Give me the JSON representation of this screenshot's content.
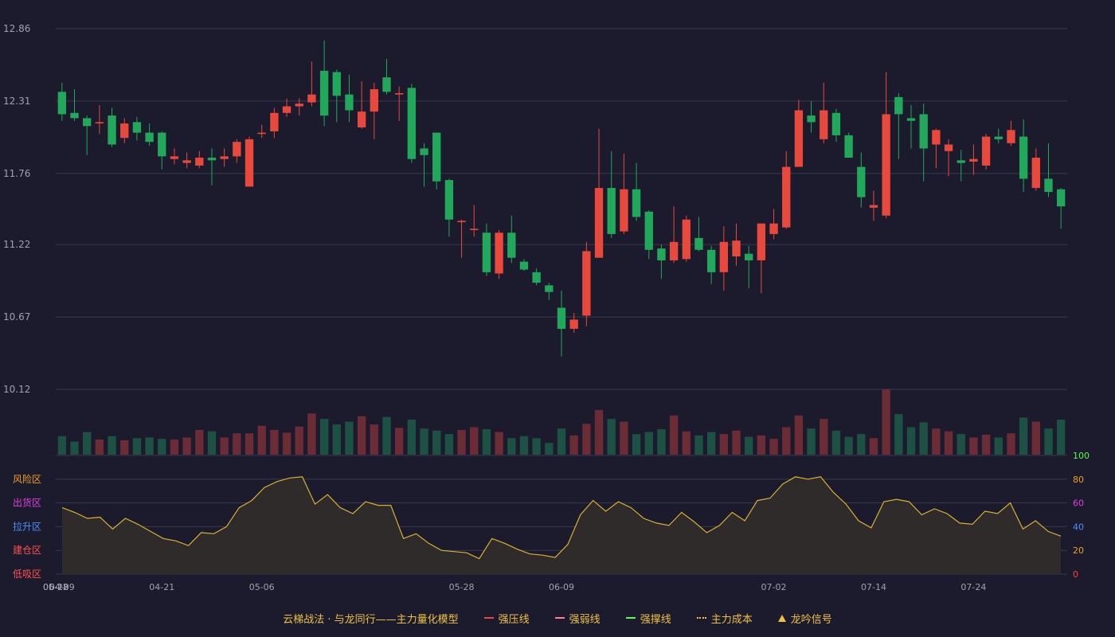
{
  "chart_data": [
    {
      "type": "candlestick",
      "panel": "price",
      "y_ticks": [
        "12.86",
        "12.31",
        "11.76",
        "11.22",
        "10.67",
        "10.12"
      ],
      "ylim": [
        10.12,
        12.86
      ],
      "grid": true,
      "up_color": "#e8493c",
      "down_color": "#22a85a",
      "x": [
        "04-09",
        "04-10",
        "04-11",
        "04-14",
        "04-15",
        "04-16",
        "04-17",
        "04-18",
        "04-21",
        "04-22",
        "04-23",
        "04-24",
        "04-25",
        "04-28",
        "04-29",
        "04-30",
        "05-06",
        "05-07",
        "05-08",
        "05-09",
        "05-12",
        "05-13",
        "05-14",
        "05-15",
        "05-16",
        "05-19",
        "05-20",
        "05-21",
        "05-22",
        "05-23",
        "05-26",
        "05-27",
        "05-28",
        "05-29",
        "05-30",
        "06-02",
        "06-03",
        "06-04",
        "06-05",
        "06-06",
        "06-09",
        "06-10",
        "06-11",
        "06-12",
        "06-13",
        "06-16",
        "06-17",
        "06-18",
        "06-19",
        "06-20",
        "06-23",
        "06-24",
        "06-25",
        "06-26",
        "06-27",
        "06-30",
        "07-01",
        "07-02",
        "07-03",
        "07-04",
        "07-07",
        "07-08",
        "07-09",
        "07-10",
        "07-11",
        "07-14",
        "07-15",
        "07-16",
        "07-17",
        "07-18",
        "07-21",
        "07-22",
        "07-23",
        "07-24",
        "07-25",
        "07-28",
        "07-29",
        "07-30",
        "07-31",
        "08-01"
      ],
      "ohlc": [
        [
          12.38,
          12.21,
          12.16,
          12.45
        ],
        [
          12.22,
          12.18,
          12.16,
          12.4
        ],
        [
          12.18,
          12.12,
          11.9,
          12.2
        ],
        [
          12.14,
          12.15,
          12.06,
          12.28
        ],
        [
          12.2,
          11.98,
          11.96,
          12.26
        ],
        [
          12.03,
          12.14,
          11.99,
          12.18
        ],
        [
          12.15,
          12.07,
          12.01,
          12.19
        ],
        [
          12.07,
          12.0,
          11.97,
          12.14
        ],
        [
          12.07,
          11.89,
          11.79,
          12.08
        ],
        [
          11.87,
          11.89,
          11.83,
          11.95
        ],
        [
          11.84,
          11.86,
          11.8,
          11.92
        ],
        [
          11.82,
          11.88,
          11.8,
          11.93
        ],
        [
          11.88,
          11.86,
          11.67,
          11.95
        ],
        [
          11.87,
          11.89,
          11.81,
          11.95
        ],
        [
          11.89,
          12.0,
          11.84,
          12.02
        ],
        [
          11.66,
          12.02,
          11.66,
          12.04
        ],
        [
          12.06,
          12.07,
          12.03,
          12.13
        ],
        [
          12.08,
          12.22,
          12.03,
          12.26
        ],
        [
          12.22,
          12.27,
          12.19,
          12.33
        ],
        [
          12.27,
          12.29,
          12.2,
          12.33
        ],
        [
          12.3,
          12.36,
          12.27,
          12.61
        ],
        [
          12.54,
          12.2,
          12.12,
          12.77
        ],
        [
          12.53,
          12.35,
          12.15,
          12.55
        ],
        [
          12.36,
          12.24,
          12.15,
          12.51
        ],
        [
          12.11,
          12.23,
          12.1,
          12.46
        ],
        [
          12.23,
          12.4,
          12.02,
          12.45
        ],
        [
          12.49,
          12.38,
          12.36,
          12.63
        ],
        [
          12.36,
          12.37,
          12.16,
          12.42
        ],
        [
          12.41,
          11.87,
          11.84,
          12.44
        ],
        [
          11.95,
          11.9,
          11.66,
          11.99
        ],
        [
          12.07,
          11.7,
          11.64,
          12.07
        ],
        [
          11.71,
          11.41,
          11.28,
          11.72
        ],
        [
          11.39,
          11.4,
          11.12,
          11.41
        ],
        [
          11.33,
          11.34,
          11.28,
          11.52
        ],
        [
          11.31,
          11.01,
          10.98,
          11.38
        ],
        [
          11.0,
          11.31,
          10.96,
          11.33
        ],
        [
          11.31,
          11.12,
          11.08,
          11.44
        ],
        [
          11.09,
          11.03,
          11.02,
          11.11
        ],
        [
          11.01,
          10.93,
          10.91,
          11.04
        ],
        [
          10.91,
          10.86,
          10.8,
          10.93
        ],
        [
          10.74,
          10.58,
          10.37,
          10.87
        ],
        [
          10.58,
          10.65,
          10.55,
          10.7
        ],
        [
          10.68,
          11.17,
          10.6,
          11.24
        ],
        [
          11.12,
          11.65,
          11.12,
          12.1
        ],
        [
          11.65,
          11.3,
          11.27,
          11.93
        ],
        [
          11.32,
          11.64,
          11.3,
          11.91
        ],
        [
          11.64,
          11.43,
          11.4,
          11.84
        ],
        [
          11.47,
          11.18,
          11.11,
          11.48
        ],
        [
          11.19,
          11.1,
          10.96,
          11.22
        ],
        [
          11.1,
          11.24,
          11.08,
          11.51
        ],
        [
          11.11,
          11.41,
          11.09,
          11.44
        ],
        [
          11.27,
          11.18,
          11.17,
          11.43
        ],
        [
          11.18,
          11.01,
          10.92,
          11.21
        ],
        [
          11.01,
          11.24,
          10.87,
          11.36
        ],
        [
          11.13,
          11.25,
          11.06,
          11.38
        ],
        [
          11.15,
          11.1,
          10.89,
          11.21
        ],
        [
          11.1,
          11.38,
          10.85,
          11.37
        ],
        [
          11.3,
          11.38,
          11.26,
          11.49
        ],
        [
          11.35,
          11.81,
          11.34,
          11.93
        ],
        [
          11.81,
          12.24,
          11.81,
          12.32
        ],
        [
          12.2,
          12.15,
          12.07,
          12.31
        ],
        [
          12.02,
          12.24,
          11.99,
          12.45
        ],
        [
          12.22,
          12.05,
          12.0,
          12.25
        ],
        [
          12.05,
          11.88,
          11.88,
          12.07
        ],
        [
          11.81,
          11.58,
          11.5,
          11.92
        ],
        [
          11.5,
          11.52,
          11.4,
          11.63
        ],
        [
          11.44,
          12.21,
          11.42,
          12.53
        ],
        [
          12.34,
          12.21,
          11.87,
          12.37
        ],
        [
          12.18,
          12.16,
          11.95,
          12.28
        ],
        [
          12.21,
          11.95,
          11.7,
          12.29
        ],
        [
          11.98,
          12.09,
          11.8,
          12.1
        ],
        [
          11.93,
          11.98,
          11.74,
          12.02
        ],
        [
          11.86,
          11.84,
          11.7,
          11.94
        ],
        [
          11.85,
          11.87,
          11.75,
          11.98
        ],
        [
          11.82,
          12.04,
          11.79,
          12.06
        ],
        [
          12.04,
          12.02,
          11.99,
          12.1
        ],
        [
          11.99,
          12.09,
          11.97,
          12.16
        ],
        [
          12.04,
          11.72,
          11.62,
          12.17
        ],
        [
          11.65,
          11.88,
          11.63,
          11.95
        ],
        [
          11.72,
          11.62,
          11.58,
          11.99
        ],
        [
          11.64,
          11.51,
          11.34,
          11.65
        ]
      ]
    },
    {
      "type": "bar",
      "panel": "volume",
      "values": [
        27,
        19,
        33,
        22,
        27,
        21,
        24,
        25,
        23,
        22,
        25,
        36,
        34,
        25,
        31,
        31,
        42,
        36,
        32,
        41,
        60,
        52,
        44,
        48,
        56,
        44,
        55,
        39,
        51,
        38,
        35,
        30,
        36,
        40,
        37,
        33,
        24,
        27,
        24,
        17,
        38,
        28,
        45,
        65,
        52,
        48,
        30,
        33,
        37,
        57,
        34,
        28,
        33,
        30,
        35,
        26,
        28,
        23,
        40,
        57,
        38,
        52,
        35,
        26,
        30,
        24,
        95,
        59,
        40,
        47,
        38,
        34,
        30,
        25,
        29,
        25,
        31,
        54,
        48,
        38,
        51
      ],
      "up_color": "#6b2c36",
      "down_color": "#1d5144"
    },
    {
      "type": "area",
      "panel": "indicator",
      "values": [
        56,
        52,
        47,
        48,
        38,
        47,
        42,
        36,
        30,
        28,
        24,
        35,
        34,
        40,
        56,
        62,
        73,
        78,
        81,
        82,
        59,
        67,
        56,
        51,
        61,
        58,
        58,
        30,
        34,
        26,
        20,
        19,
        18,
        13,
        30,
        26,
        21,
        17,
        16,
        14,
        25,
        50,
        62,
        53,
        61,
        56,
        47,
        43,
        41,
        52,
        44,
        35,
        41,
        52,
        45,
        62,
        64,
        76,
        82,
        80,
        82,
        69,
        59,
        45,
        39,
        61,
        63,
        61,
        50,
        55,
        51,
        43,
        42,
        53,
        51,
        60,
        38,
        45,
        36,
        32
      ],
      "ylim": [
        0,
        100
      ],
      "grid": true,
      "y_ticks_right": [
        "100",
        "80",
        "60",
        "40",
        "20",
        "0"
      ],
      "zone_labels": [
        "风险区",
        "出货区",
        "拉升区",
        "建仓区",
        "低吸区"
      ],
      "line_color": "#d7b12f"
    }
  ],
  "x_tick_labels": [
    "04-09",
    "04-21",
    "05-06",
    "05-18",
    "05-28",
    "06-09",
    "06-22",
    "07-02",
    "07-14",
    "07-24"
  ],
  "legend": {
    "title": "云梯战法 · 与龙同行——主力量化模型",
    "items": [
      {
        "label": "强压线",
        "color": "#e8493c",
        "style": "solid"
      },
      {
        "label": "强弱线",
        "color": "#ff7f96",
        "style": "dashed"
      },
      {
        "label": "强撑线",
        "color": "#4cff4c",
        "style": "solid"
      },
      {
        "label": "主力成本",
        "color": "#f0c040",
        "style": "dotted"
      },
      {
        "label": "龙吟信号",
        "color": "#f0c040",
        "style": "triangle"
      }
    ]
  }
}
